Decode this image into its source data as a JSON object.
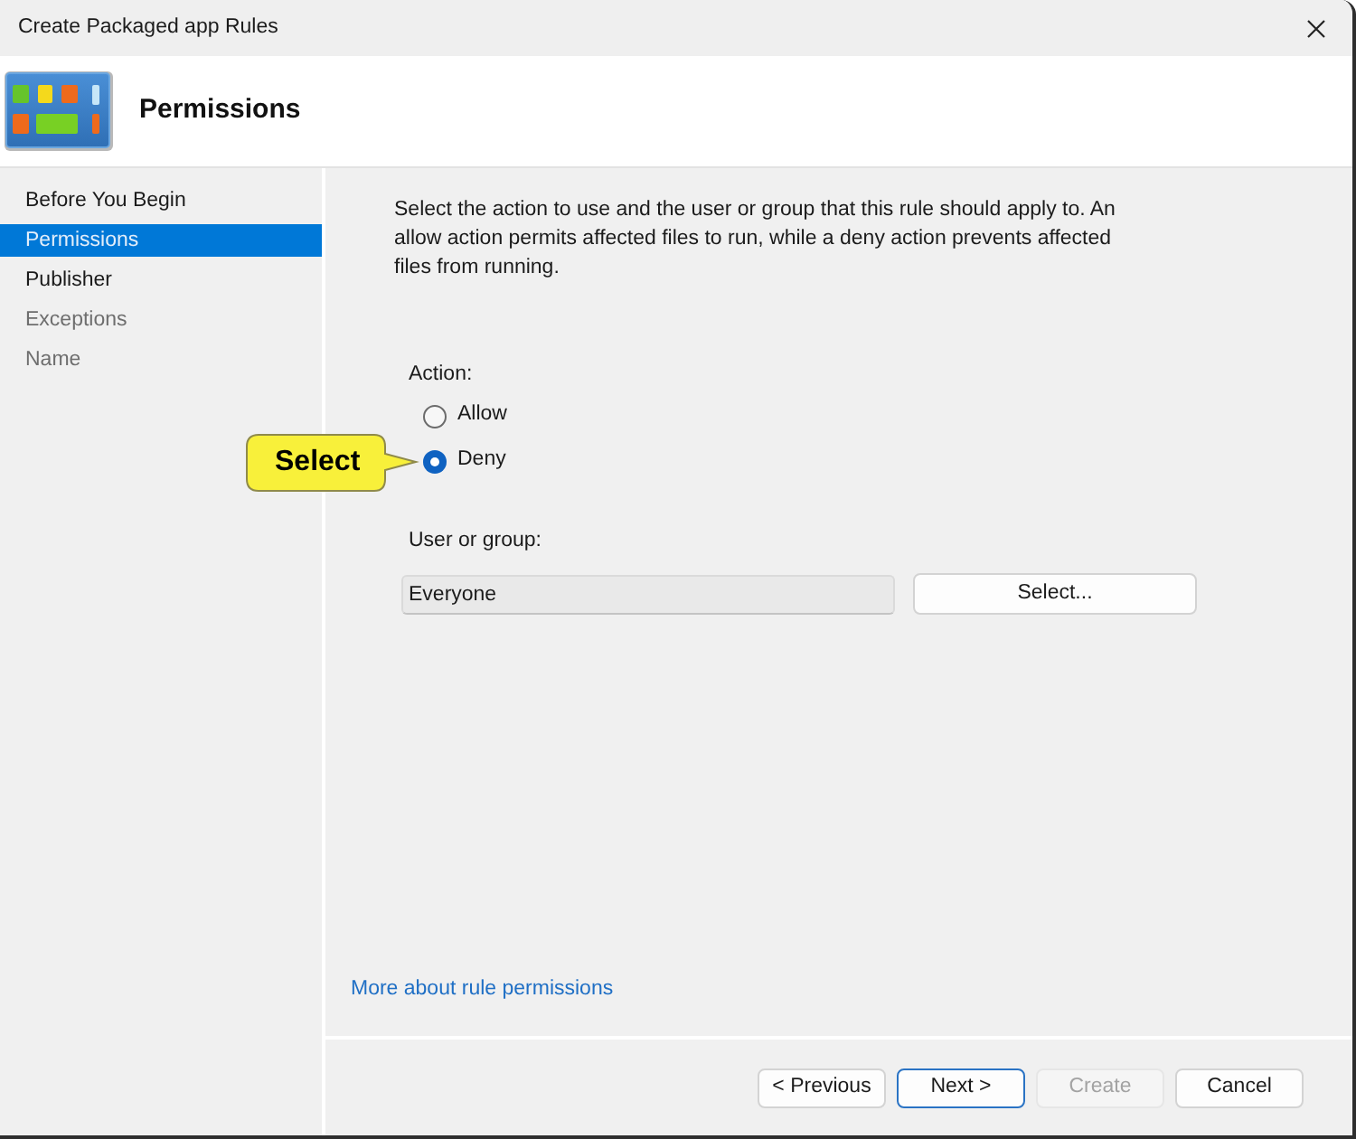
{
  "window": {
    "title": "Create Packaged app Rules"
  },
  "header": {
    "title": "Permissions"
  },
  "steps": [
    {
      "label": "Before You Begin",
      "selected": false,
      "disabled": false
    },
    {
      "label": "Permissions",
      "selected": true,
      "disabled": false
    },
    {
      "label": "Publisher",
      "selected": false,
      "disabled": false
    },
    {
      "label": "Exceptions",
      "selected": false,
      "disabled": true
    },
    {
      "label": "Name",
      "selected": false,
      "disabled": true
    }
  ],
  "description": "Select the action to use and the user or group that this rule should apply to. An allow action permits affected files to run, while a deny action prevents affected files from running.",
  "action": {
    "label": "Action:",
    "options": [
      {
        "label": "Allow",
        "selected": false
      },
      {
        "label": "Deny",
        "selected": true
      }
    ]
  },
  "user_group": {
    "label": "User or group:",
    "value": "Everyone",
    "button": "Select..."
  },
  "callout": {
    "text": "Select"
  },
  "help_link": "More about rule permissions",
  "buttons": [
    {
      "label": "< Previous",
      "default": false,
      "disabled": false
    },
    {
      "label": "Next >",
      "default": true,
      "disabled": false
    },
    {
      "label": "Create",
      "default": false,
      "disabled": true
    },
    {
      "label": "Cancel",
      "default": false,
      "disabled": false
    }
  ]
}
